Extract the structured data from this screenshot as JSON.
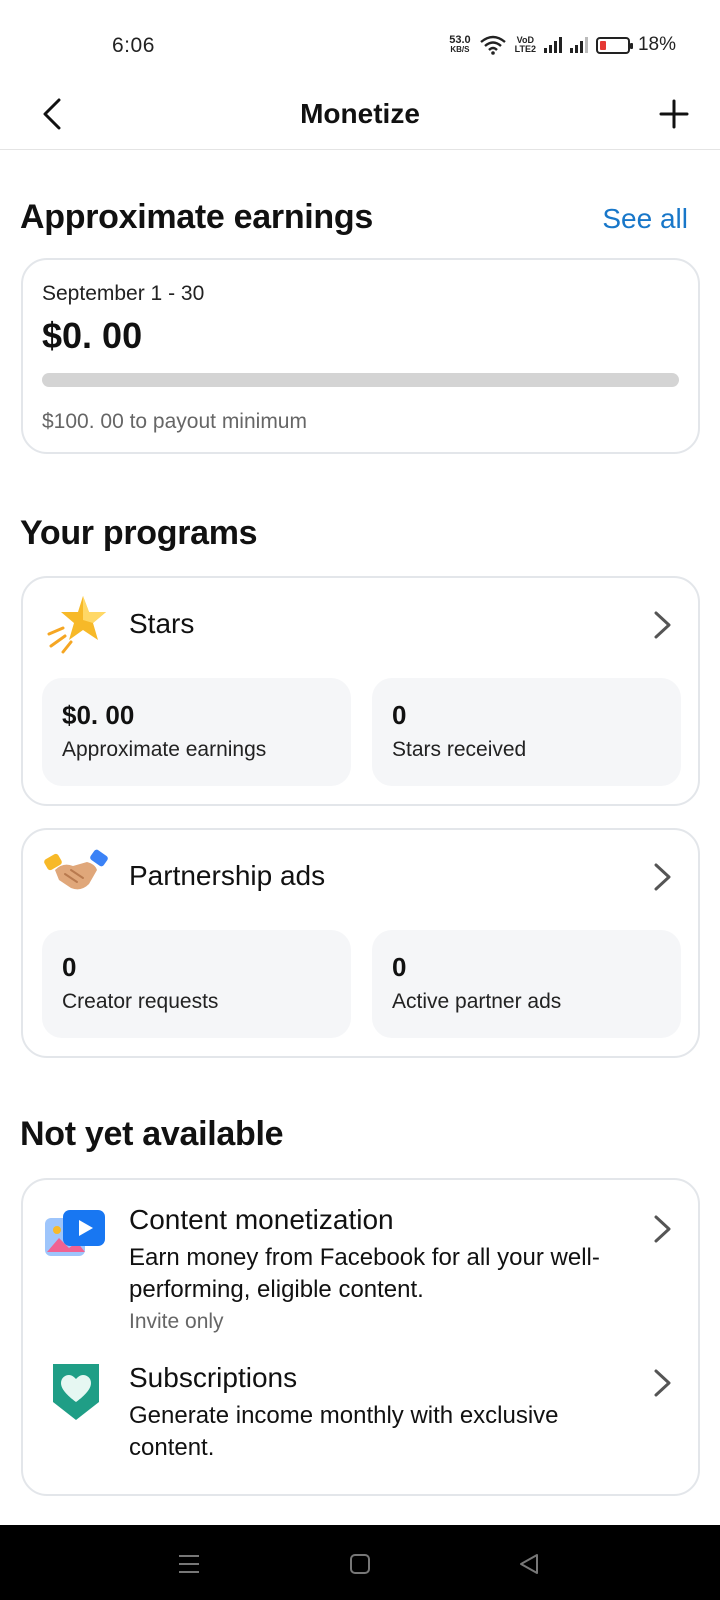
{
  "status_bar": {
    "time": "6:06",
    "net_speed_value": "53.0",
    "net_speed_unit": "KB/S",
    "volte_top": "VoD",
    "volte_bottom": "LTE2",
    "battery_percent": "18%"
  },
  "app_bar": {
    "title": "Monetize"
  },
  "earnings": {
    "heading": "Approximate earnings",
    "see_all": "See all",
    "period": "September 1 - 30",
    "amount": "$0. 00",
    "progress": 0,
    "payout_note": "$100. 00 to payout minimum"
  },
  "programs": {
    "heading": "Your programs",
    "stars": {
      "name": "Stars",
      "stat1_value": "$0. 00",
      "stat1_label": "Approximate earnings",
      "stat2_value": "0",
      "stat2_label": "Stars received"
    },
    "partnership": {
      "name": "Partnership ads",
      "stat1_value": "0",
      "stat1_label": "Creator requests",
      "stat2_value": "0",
      "stat2_label": "Active partner ads"
    }
  },
  "not_available": {
    "heading": "Not yet available",
    "content_monetization": {
      "title": "Content monetization",
      "desc": "Earn money from Facebook for all your well-performing,  eligible content.",
      "note": "Invite only"
    },
    "subscriptions": {
      "title": "Subscriptions",
      "desc": "Generate income monthly with exclusive content."
    }
  },
  "colors": {
    "link": "#1877c9",
    "card_border": "#e3e6ea",
    "stat_bg": "#f5f6f8",
    "battery_low": "#e53935"
  }
}
